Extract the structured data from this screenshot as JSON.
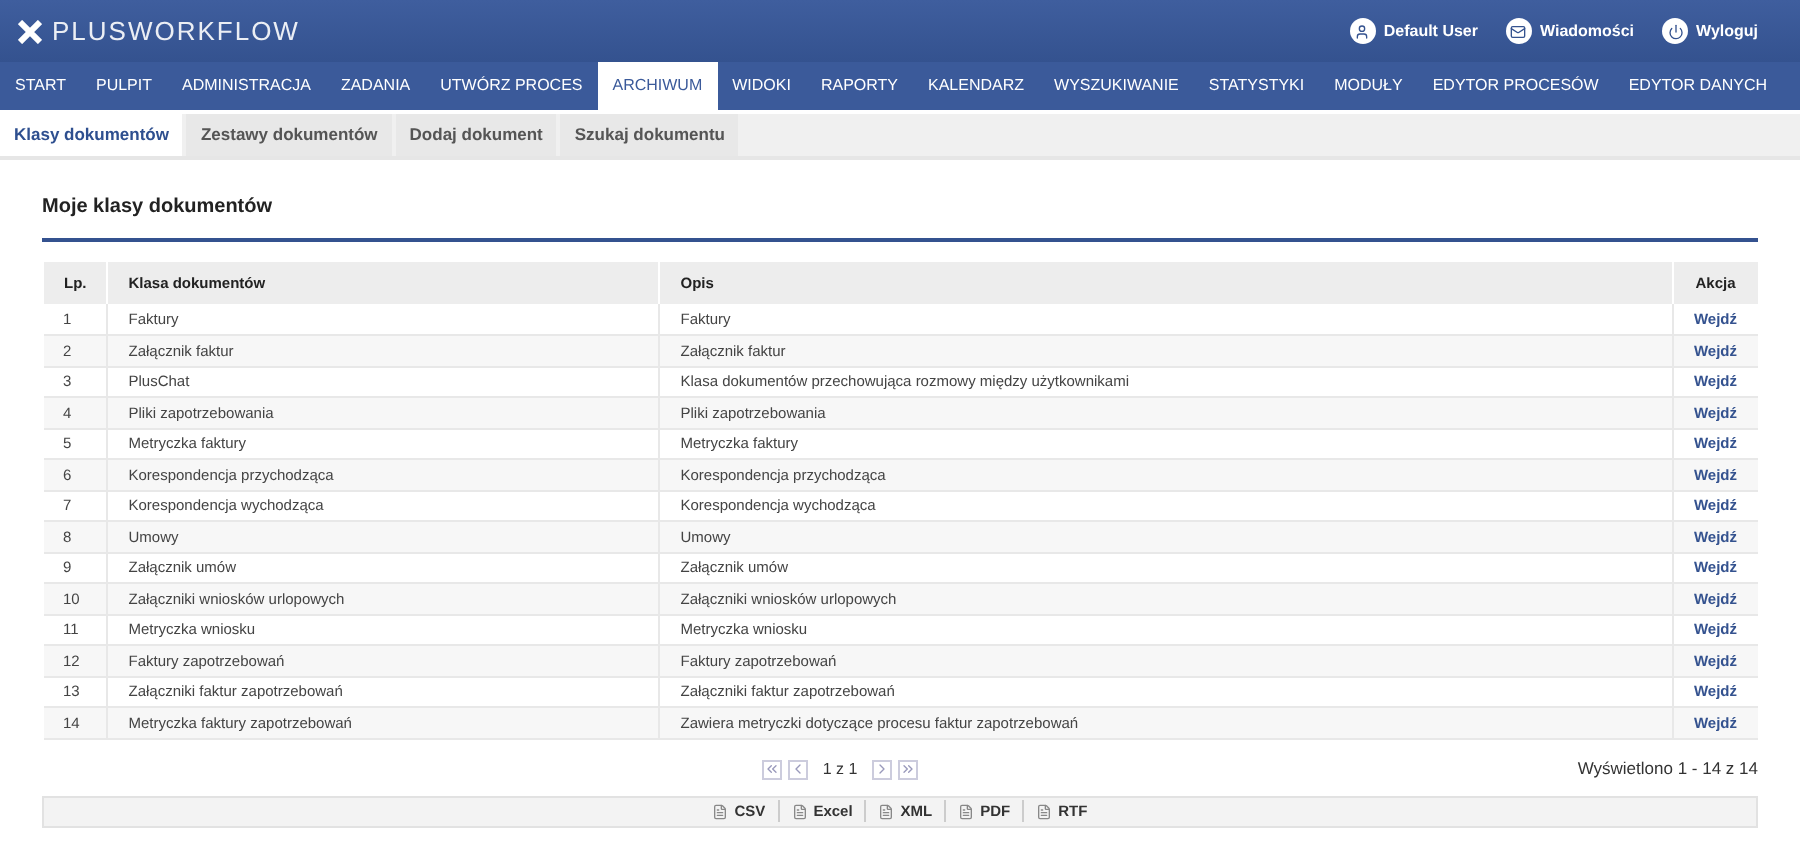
{
  "header": {
    "logo": "PLUSWORKFLOW",
    "user_links": [
      {
        "kind": "user",
        "label": "Default User"
      },
      {
        "kind": "messages",
        "label": "Wiadomości"
      },
      {
        "kind": "logout",
        "label": "Wyloguj"
      }
    ]
  },
  "nav": [
    {
      "label": "START",
      "selected": false
    },
    {
      "label": "PULPIT",
      "selected": false
    },
    {
      "label": "ADMINISTRACJA",
      "selected": false
    },
    {
      "label": "ZADANIA",
      "selected": false
    },
    {
      "label": "UTWÓRZ PROCES",
      "selected": false
    },
    {
      "label": "ARCHIWUM",
      "selected": true
    },
    {
      "label": "WIDOKI",
      "selected": false
    },
    {
      "label": "RAPORTY",
      "selected": false
    },
    {
      "label": "KALENDARZ",
      "selected": false
    },
    {
      "label": "WYSZUKIWANIE",
      "selected": false
    },
    {
      "label": "STATYSTYKI",
      "selected": false
    },
    {
      "label": "MODUŁY",
      "selected": false
    },
    {
      "label": "EDYTOR PROCESÓW",
      "selected": false
    },
    {
      "label": "EDYTOR DANYCH",
      "selected": false
    }
  ],
  "subtabs": [
    {
      "label": "Klasy dokumentów",
      "selected": true
    },
    {
      "label": "Zestawy dokumentów",
      "selected": false
    },
    {
      "label": "Dodaj dokument",
      "selected": false
    },
    {
      "label": "Szukaj dokumentu",
      "selected": false
    }
  ],
  "page_title": "Moje klasy dokumentów",
  "table": {
    "columns": [
      "Lp.",
      "Klasa dokumentów",
      "Opis",
      "Akcja"
    ],
    "rows": [
      [
        "1",
        "Faktury",
        "Faktury",
        "Wejdź"
      ],
      [
        "2",
        "Załącznik faktur",
        "Załącznik faktur",
        "Wejdź"
      ],
      [
        "3",
        "PlusChat",
        "Klasa dokumentów przechowująca rozmowy między użytkownikami",
        "Wejdź"
      ],
      [
        "4",
        "Pliki zapotrzebowania",
        "Pliki zapotrzebowania",
        "Wejdź"
      ],
      [
        "5",
        "Metryczka faktury",
        "Metryczka faktury",
        "Wejdź"
      ],
      [
        "6",
        "Korespondencja przychodząca",
        "Korespondencja przychodząca",
        "Wejdź"
      ],
      [
        "7",
        "Korespondencja wychodząca",
        "Korespondencja wychodząca",
        "Wejdź"
      ],
      [
        "8",
        "Umowy",
        "Umowy",
        "Wejdź"
      ],
      [
        "9",
        "Załącznik umów",
        "Załącznik umów",
        "Wejdź"
      ],
      [
        "10",
        "Załączniki wniosków urlopowych",
        "Załączniki wniosków urlopowych",
        "Wejdź"
      ],
      [
        "11",
        "Metryczka wniosku",
        "Metryczka wniosku",
        "Wejdź"
      ],
      [
        "12",
        "Faktury zapotrzebowań",
        "Faktury zapotrzebowań",
        "Wejdź"
      ],
      [
        "13",
        "Załączniki faktur zapotrzebowań",
        "Załączniki faktur zapotrzebowań",
        "Wejdź"
      ],
      [
        "14",
        "Metryczka faktury zapotrzebowań",
        "Zawiera metryczki dotyczące procesu faktur zapotrzebowań",
        "Wejdź"
      ]
    ]
  },
  "pagination": {
    "page": "1 z 1",
    "summary": "Wyświetlono 1 - 14 z 14"
  },
  "exports": [
    "CSV",
    "Excel",
    "XML",
    "PDF",
    "RTF"
  ]
}
